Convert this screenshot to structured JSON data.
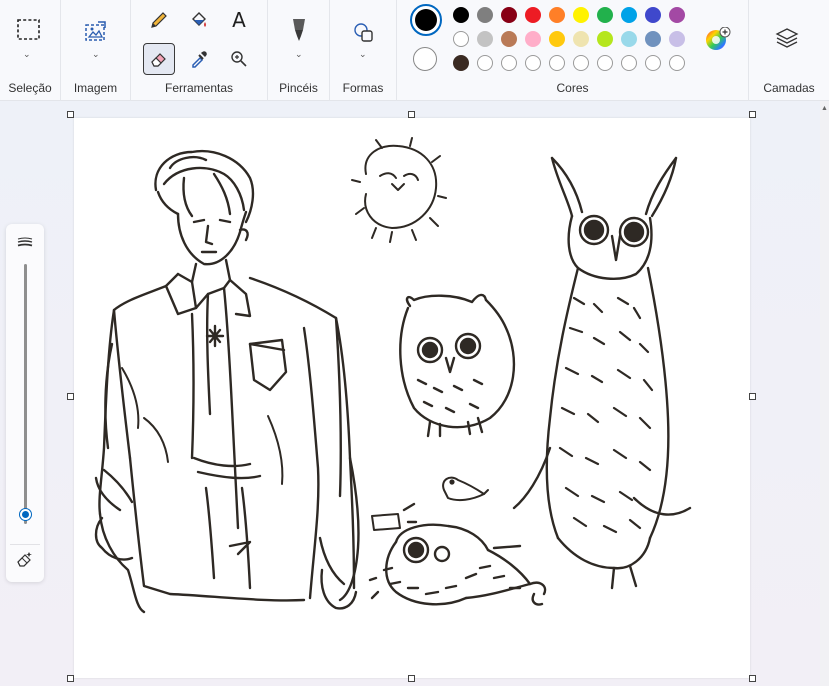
{
  "ribbon": {
    "groups": {
      "selection": {
        "label": "Seleção",
        "icon": "selection-rectangle-icon"
      },
      "image": {
        "label": "Imagem",
        "icon": "image-crop-icon"
      },
      "tools": {
        "label": "Ferramentas",
        "items": [
          {
            "name": "pencil-icon"
          },
          {
            "name": "fill-bucket-icon"
          },
          {
            "name": "text-icon",
            "glyph": "A"
          },
          {
            "name": "eraser-icon",
            "active": true
          },
          {
            "name": "color-picker-icon"
          },
          {
            "name": "magnifier-icon"
          }
        ]
      },
      "brushes": {
        "label": "Pincéis",
        "icon": "brush-icon"
      },
      "shapes": {
        "label": "Formas",
        "icon": "shapes-icon"
      },
      "colors": {
        "label": "Cores",
        "primary": "#000000",
        "secondary": "#ffffff",
        "tertiary": "#3a2a22",
        "row1": [
          "#000000",
          "#7f7f7f",
          "#880015",
          "#ed1c24",
          "#ff7f27",
          "#fff200",
          "#22b14c",
          "#00a2e8",
          "#3f48cc",
          "#a349a4"
        ],
        "row2": [
          "#ffffff",
          "#c3c3c3",
          "#b97a57",
          "#ffaec9",
          "#ffc90e",
          "#efe4b0",
          "#b5e61d",
          "#99d9ea",
          "#7092be",
          "#c8bfe7"
        ],
        "row3_empty_count": 9
      },
      "layers": {
        "label": "Camadas",
        "icon": "layers-icon"
      }
    }
  },
  "sidebar": {
    "icon_top": "brush-size-icon",
    "icon_bottom": "eraser-clear-icon",
    "size_value": 0.04
  }
}
